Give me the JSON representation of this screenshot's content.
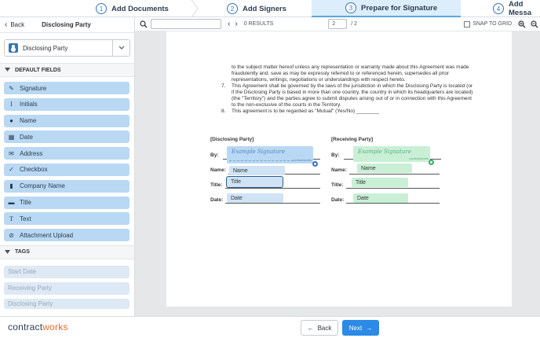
{
  "stepper": {
    "steps": [
      {
        "num": "1",
        "label": "Add Documents"
      },
      {
        "num": "2",
        "label": "Add Signers"
      },
      {
        "num": "3",
        "label": "Prepare for Signature"
      },
      {
        "num": "4",
        "label": "Add Messa"
      }
    ],
    "active_step": 3
  },
  "sidebar": {
    "back_label": "Back",
    "title": "Disclosing Party",
    "party_select": "Disclosing Party",
    "default_fields_header": "DEFAULT FIELDS",
    "fields": [
      {
        "label": "Signature",
        "icon": "pen-icon"
      },
      {
        "label": "Initials",
        "icon": "initials-icon"
      },
      {
        "label": "Name",
        "icon": "person-icon"
      },
      {
        "label": "Date",
        "icon": "calendar-icon"
      },
      {
        "label": "Address",
        "icon": "envelope-icon"
      },
      {
        "label": "Checkbox",
        "icon": "check-icon"
      },
      {
        "label": "Company Name",
        "icon": "building-icon"
      },
      {
        "label": "Title",
        "icon": "briefcase-icon"
      },
      {
        "label": "Text",
        "icon": "text-icon"
      },
      {
        "label": "Attachment Upload",
        "icon": "paperclip-icon"
      }
    ],
    "tags_header": "TAGS",
    "tags": [
      "Start Date",
      "Receiving Party",
      "Disclosing Party"
    ]
  },
  "toolbar": {
    "search_value": "",
    "results_text": "0 RESULTS",
    "page_value": "2",
    "page_total": "/ 2",
    "snap_label": "SNAP TO GRID"
  },
  "document": {
    "lines": [
      "to the subject matter hereof unless any representation or warranty made about this Agreement was made",
      "fraudulently and, save as may be expressly referred to or referenced herein, supersedes all prior",
      "representations, writings, negotiations or understandings with respect hereto.",
      "This Agreement shall be governed by the laws of the jurisdiction in which the Disclosing Party is located (or",
      "if the Disclosing Party is based in more than one country, the country in which its headquarters are located)",
      "(the \"Territory\") and the parties agree to submit disputes arising out of or in connection with this Agreement",
      "to the non-exclusive of the courts in the Territory.",
      "This agreement is to be regarded as \"Mutual\" (Yes/No) ________"
    ],
    "num7": "7.",
    "num8": "8.",
    "disclosing_header": "[Disclosing Party]",
    "receiving_header": "[Receiving Party]",
    "by_label": "By:",
    "name_label": "Name:",
    "title_label": "Title:",
    "date_label": "Date:",
    "sig_example": "Example Signature",
    "sig_brand": "contractworks",
    "field_name": "Name",
    "field_title": "Title",
    "field_date": "Date"
  },
  "footer": {
    "logo_a": "contract",
    "logo_b": "works",
    "back_label": "Back",
    "next_label": "Next"
  },
  "colors": {
    "accent": "#2b8be6",
    "field_blue": "#b9d8f3",
    "field_green": "#c9efd6",
    "logo_orange": "#e86a2a"
  }
}
